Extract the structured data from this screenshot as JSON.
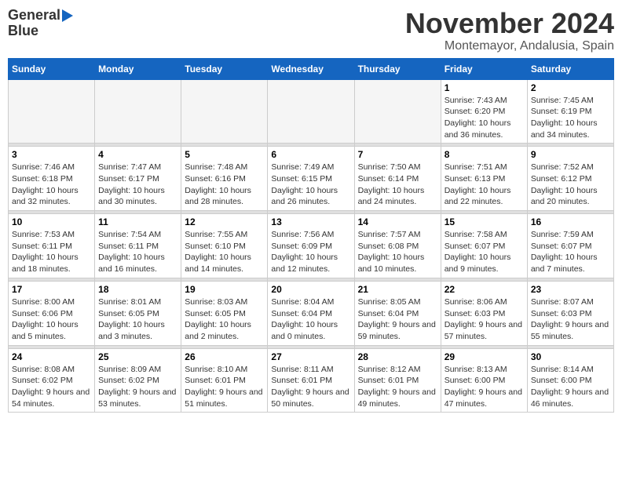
{
  "logo": {
    "line1": "General",
    "line2": "Blue"
  },
  "title": "November 2024",
  "subtitle": "Montemayor, Andalusia, Spain",
  "days_header": [
    "Sunday",
    "Monday",
    "Tuesday",
    "Wednesday",
    "Thursday",
    "Friday",
    "Saturday"
  ],
  "weeks": [
    [
      {
        "day": "",
        "info": ""
      },
      {
        "day": "",
        "info": ""
      },
      {
        "day": "",
        "info": ""
      },
      {
        "day": "",
        "info": ""
      },
      {
        "day": "",
        "info": ""
      },
      {
        "day": "1",
        "info": "Sunrise: 7:43 AM\nSunset: 6:20 PM\nDaylight: 10 hours and 36 minutes."
      },
      {
        "day": "2",
        "info": "Sunrise: 7:45 AM\nSunset: 6:19 PM\nDaylight: 10 hours and 34 minutes."
      }
    ],
    [
      {
        "day": "3",
        "info": "Sunrise: 7:46 AM\nSunset: 6:18 PM\nDaylight: 10 hours and 32 minutes."
      },
      {
        "day": "4",
        "info": "Sunrise: 7:47 AM\nSunset: 6:17 PM\nDaylight: 10 hours and 30 minutes."
      },
      {
        "day": "5",
        "info": "Sunrise: 7:48 AM\nSunset: 6:16 PM\nDaylight: 10 hours and 28 minutes."
      },
      {
        "day": "6",
        "info": "Sunrise: 7:49 AM\nSunset: 6:15 PM\nDaylight: 10 hours and 26 minutes."
      },
      {
        "day": "7",
        "info": "Sunrise: 7:50 AM\nSunset: 6:14 PM\nDaylight: 10 hours and 24 minutes."
      },
      {
        "day": "8",
        "info": "Sunrise: 7:51 AM\nSunset: 6:13 PM\nDaylight: 10 hours and 22 minutes."
      },
      {
        "day": "9",
        "info": "Sunrise: 7:52 AM\nSunset: 6:12 PM\nDaylight: 10 hours and 20 minutes."
      }
    ],
    [
      {
        "day": "10",
        "info": "Sunrise: 7:53 AM\nSunset: 6:11 PM\nDaylight: 10 hours and 18 minutes."
      },
      {
        "day": "11",
        "info": "Sunrise: 7:54 AM\nSunset: 6:11 PM\nDaylight: 10 hours and 16 minutes."
      },
      {
        "day": "12",
        "info": "Sunrise: 7:55 AM\nSunset: 6:10 PM\nDaylight: 10 hours and 14 minutes."
      },
      {
        "day": "13",
        "info": "Sunrise: 7:56 AM\nSunset: 6:09 PM\nDaylight: 10 hours and 12 minutes."
      },
      {
        "day": "14",
        "info": "Sunrise: 7:57 AM\nSunset: 6:08 PM\nDaylight: 10 hours and 10 minutes."
      },
      {
        "day": "15",
        "info": "Sunrise: 7:58 AM\nSunset: 6:07 PM\nDaylight: 10 hours and 9 minutes."
      },
      {
        "day": "16",
        "info": "Sunrise: 7:59 AM\nSunset: 6:07 PM\nDaylight: 10 hours and 7 minutes."
      }
    ],
    [
      {
        "day": "17",
        "info": "Sunrise: 8:00 AM\nSunset: 6:06 PM\nDaylight: 10 hours and 5 minutes."
      },
      {
        "day": "18",
        "info": "Sunrise: 8:01 AM\nSunset: 6:05 PM\nDaylight: 10 hours and 3 minutes."
      },
      {
        "day": "19",
        "info": "Sunrise: 8:03 AM\nSunset: 6:05 PM\nDaylight: 10 hours and 2 minutes."
      },
      {
        "day": "20",
        "info": "Sunrise: 8:04 AM\nSunset: 6:04 PM\nDaylight: 10 hours and 0 minutes."
      },
      {
        "day": "21",
        "info": "Sunrise: 8:05 AM\nSunset: 6:04 PM\nDaylight: 9 hours and 59 minutes."
      },
      {
        "day": "22",
        "info": "Sunrise: 8:06 AM\nSunset: 6:03 PM\nDaylight: 9 hours and 57 minutes."
      },
      {
        "day": "23",
        "info": "Sunrise: 8:07 AM\nSunset: 6:03 PM\nDaylight: 9 hours and 55 minutes."
      }
    ],
    [
      {
        "day": "24",
        "info": "Sunrise: 8:08 AM\nSunset: 6:02 PM\nDaylight: 9 hours and 54 minutes."
      },
      {
        "day": "25",
        "info": "Sunrise: 8:09 AM\nSunset: 6:02 PM\nDaylight: 9 hours and 53 minutes."
      },
      {
        "day": "26",
        "info": "Sunrise: 8:10 AM\nSunset: 6:01 PM\nDaylight: 9 hours and 51 minutes."
      },
      {
        "day": "27",
        "info": "Sunrise: 8:11 AM\nSunset: 6:01 PM\nDaylight: 9 hours and 50 minutes."
      },
      {
        "day": "28",
        "info": "Sunrise: 8:12 AM\nSunset: 6:01 PM\nDaylight: 9 hours and 49 minutes."
      },
      {
        "day": "29",
        "info": "Sunrise: 8:13 AM\nSunset: 6:00 PM\nDaylight: 9 hours and 47 minutes."
      },
      {
        "day": "30",
        "info": "Sunrise: 8:14 AM\nSunset: 6:00 PM\nDaylight: 9 hours and 46 minutes."
      }
    ]
  ]
}
